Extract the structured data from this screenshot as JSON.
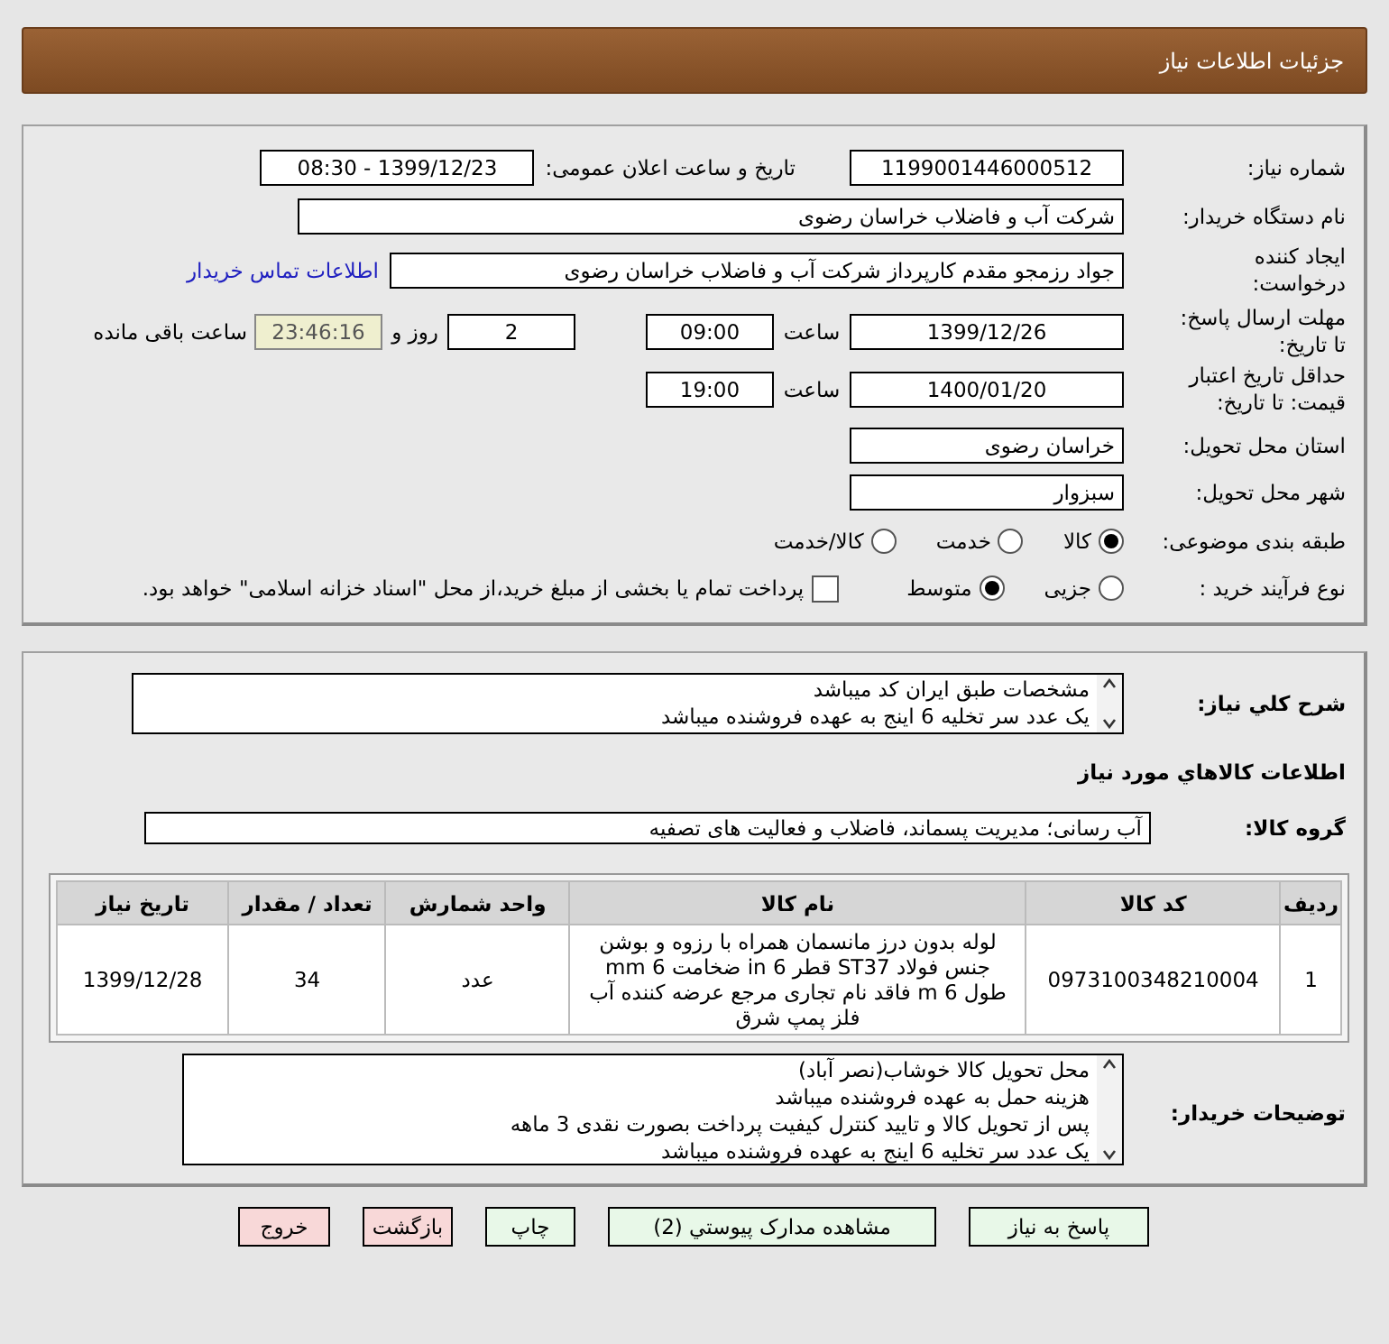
{
  "header": {
    "title": "جزئیات اطلاعات نیاز"
  },
  "need_number": {
    "label": "شماره نیاز:",
    "value": "1199001446000512"
  },
  "announce": {
    "label": "تاریخ و ساعت اعلان عمومی:",
    "value": "1399/12/23 - 08:30"
  },
  "buyer_org": {
    "label": "نام دستگاه خریدار:",
    "value": "شرکت آب و فاضلاب خراسان رضوی"
  },
  "creator": {
    "label": "ایجاد کننده\nدرخواست:",
    "value": "جواد رزمجو مقدم  کارپرداز شرکت آب و فاضلاب خراسان رضوی",
    "link": "اطلاعات تماس خریدار"
  },
  "deadline": {
    "label": "مهلت ارسال پاسخ:\nتا تاریخ:",
    "date": "1399/12/26",
    "time_label": "ساعت",
    "time": "09:00",
    "days": "2",
    "days_label": "روز و",
    "remaining": "23:46:16",
    "remaining_label": "ساعت باقی مانده"
  },
  "validity": {
    "label": "حداقل تاریخ اعتبار\nقیمت: تا تاریخ:",
    "date": "1400/01/20",
    "time_label": "ساعت",
    "time": "19:00"
  },
  "province": {
    "label": "استان محل تحویل:",
    "value": "خراسان رضوی"
  },
  "city": {
    "label": "شهر محل تحویل:",
    "value": "سبزوار"
  },
  "category": {
    "label": "طبقه بندی موضوعی:",
    "options": [
      {
        "label": "کالا",
        "selected": true
      },
      {
        "label": "خدمت",
        "selected": false
      },
      {
        "label": "کالا/خدمت",
        "selected": false
      }
    ]
  },
  "process": {
    "label": "نوع فرآیند خرید :",
    "options": [
      {
        "label": "جزیی",
        "selected": false
      },
      {
        "label": "متوسط",
        "selected": true
      }
    ],
    "payment": {
      "label": "پرداخت تمام یا بخشی از مبلغ خرید،از محل \"اسناد خزانه اسلامی\" خواهد بود.",
      "checked": false
    }
  },
  "description": {
    "label": "شرح کلي نياز:",
    "lines": [
      "مشخصات طبق ایران کد میباشد",
      "یک عدد سر تخلیه 6 اینج به عهده فروشنده میباشد"
    ]
  },
  "goods_title": "اطلاعات کالاهاي مورد نياز",
  "goods_group": {
    "label": "گروه کالا:",
    "value": "آب رسانی؛ مدیریت پسماند، فاضلاب و فعالیت های تصفیه"
  },
  "table": {
    "columns": [
      "ردیف",
      "کد کالا",
      "نام کالا",
      "واحد شمارش",
      "تعداد / مقدار",
      "تاریخ نیاز"
    ],
    "rows": [
      [
        "1",
        "0973100348210004",
        "لوله بدون درز مانسمان همراه با رزوه و بوشن جنس فولاد ST37 قطر 6 in ضخامت 6 mm طول 6 m فاقد نام تجاری مرجع عرضه کننده آب فلز پمپ شرق",
        "عدد",
        "34",
        "1399/12/28"
      ]
    ]
  },
  "buyer_notes": {
    "label": "توضیحات خریدار:",
    "lines": [
      "محل تحویل کالا خوشاب(نصر آباد)",
      "هزینه حمل به عهده فروشنده میباشد",
      "پس از تحویل کالا و تایید کنترل کیفیت پرداخت بصورت نقدی 3 ماهه",
      "یک عدد سر تخلیه 6 اینج به عهده فروشنده میباشد"
    ]
  },
  "buttons": [
    {
      "label": "پاسخ به نیاز",
      "kind": "action"
    },
    {
      "label": "مشاهده مدارک پیوستي (2)",
      "kind": "action"
    },
    {
      "label": "چاپ",
      "kind": "action"
    },
    {
      "label": "بازگشت",
      "kind": "exit"
    },
    {
      "label": "خروج",
      "kind": "exit"
    }
  ]
}
